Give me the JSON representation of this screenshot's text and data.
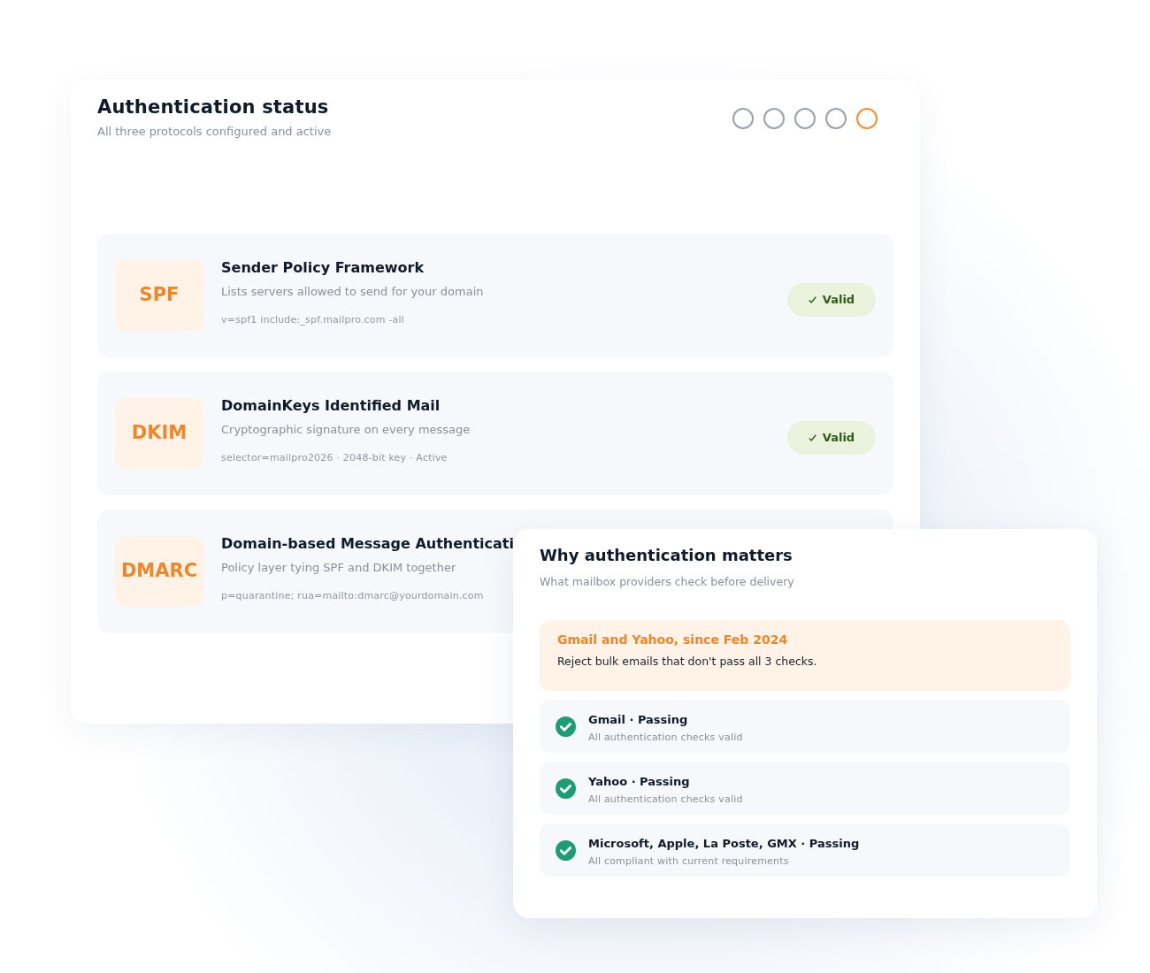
{
  "header": {
    "title": "Authentication status",
    "subtitle": "All three protocols configured and active",
    "dots": [
      {
        "selected": false
      },
      {
        "selected": false
      },
      {
        "selected": false
      },
      {
        "selected": false
      },
      {
        "selected": true
      }
    ]
  },
  "protocols": [
    {
      "abbr": "SPF",
      "name": "Sender Policy Framework",
      "description": "Lists servers allowed to send for your domain",
      "record": "v=spf1 include:_spf.mailpro.com -all",
      "status": {
        "kind": "valid",
        "label": "Valid"
      }
    },
    {
      "abbr": "DKIM",
      "name": "DomainKeys Identified Mail",
      "description": "Cryptographic signature on every message",
      "record": "selector=mailpro2026 · 2048-bit key · Active",
      "status": {
        "kind": "valid",
        "label": "Valid"
      }
    },
    {
      "abbr": "DMARC",
      "name": "Domain-based Message Authenticati",
      "description": "Policy layer tying SPF and DKIM together",
      "record": "p=quarantine; rua=mailto:dmarc@yourdomain.com"
    }
  ],
  "info_panel": {
    "title": "Why authentication matters",
    "subtitle": "What mailbox providers check before delivery",
    "notice": {
      "title": "Gmail and Yahoo, since Feb 2024",
      "text": "Reject bulk emails that don't pass all 3 checks."
    },
    "providers": [
      {
        "name": "Gmail · Passing",
        "detail": "All authentication checks valid",
        "passed": true
      },
      {
        "name": "Yahoo · Passing",
        "detail": "All authentication checks valid",
        "passed": true
      },
      {
        "name": "Microsoft, Apple, La Poste, GMX · Passing",
        "detail": "All compliant with current requirements",
        "passed": true
      }
    ]
  }
}
